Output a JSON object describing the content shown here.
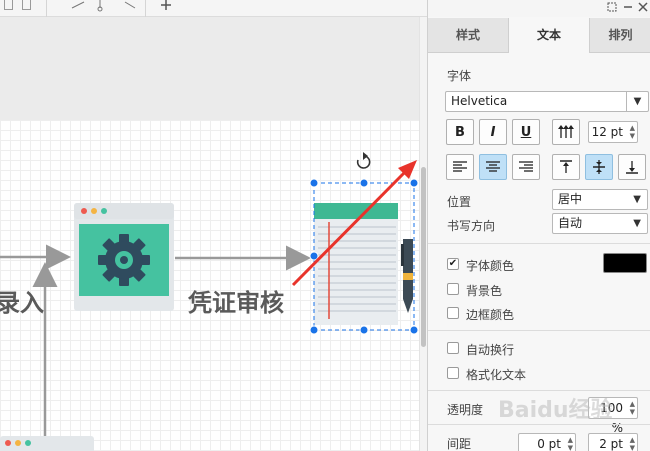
{
  "canvas": {
    "label_left_partial": "录入",
    "label_review": "凭证审核",
    "colors": {
      "arrow_gray": "#999999",
      "gear_card": "#45c2a0",
      "gear_color": "#2f4b5e",
      "selection": "#1a73e8",
      "red_arrow": "#e8332b"
    }
  },
  "panel": {
    "tabs": [
      {
        "label": "样式"
      },
      {
        "label": "文本",
        "active": true
      },
      {
        "label": "排列"
      }
    ],
    "font_section_label": "字体",
    "font_family": "Helvetica",
    "font_size": "12 pt",
    "bold_glyph": "B",
    "italic_glyph": "I",
    "underline_glyph": "U",
    "position_label": "位置",
    "position_value": "居中",
    "direction_label": "书写方向",
    "direction_value": "自动",
    "font_color_label": "字体颜色",
    "font_color_checked": true,
    "font_color_value": "#000000",
    "background_label": "背景色",
    "border_color_label": "边框颜色",
    "word_wrap_label": "自动换行",
    "formatted_text_label": "格式化文本",
    "opacity_label": "透明度",
    "opacity_value": "100 %",
    "spacing_label": "间距",
    "spacing_value_1": "0 pt",
    "spacing_value_2": "2 pt"
  },
  "watermark": "Baidu经验"
}
